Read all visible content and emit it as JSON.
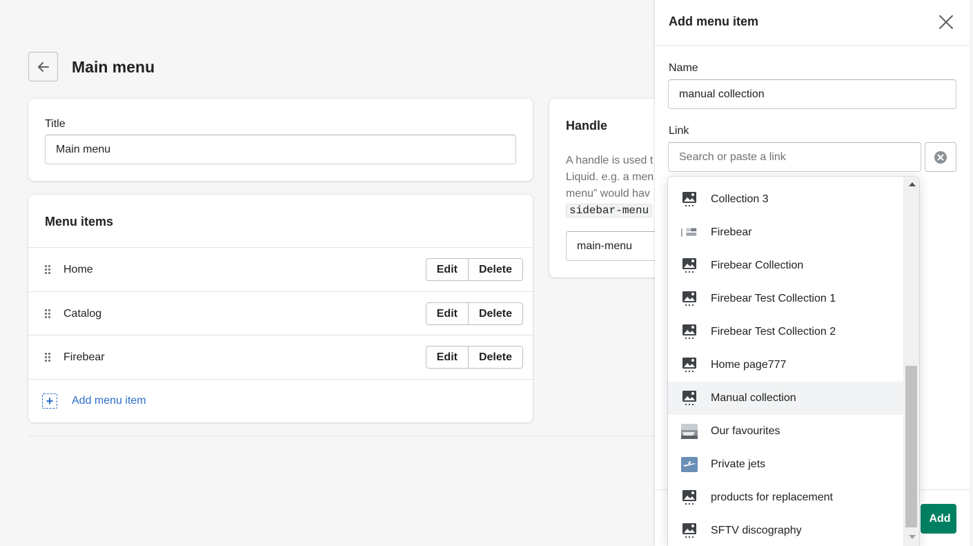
{
  "page": {
    "title": "Main menu"
  },
  "title_card": {
    "label": "Title",
    "value": "Main menu"
  },
  "menu_items": {
    "heading": "Menu items",
    "items": [
      {
        "label": "Home",
        "edit": "Edit",
        "delete": "Delete"
      },
      {
        "label": "Catalog",
        "edit": "Edit",
        "delete": "Delete"
      },
      {
        "label": "Firebear",
        "edit": "Edit",
        "delete": "Delete"
      }
    ],
    "add_label": "Add menu item"
  },
  "handle_card": {
    "heading": "Handle",
    "desc_line1": "A handle is used t",
    "desc_line2": "Liquid. e.g. a men",
    "desc_line3": "menu” would hav",
    "code": "sidebar-menu",
    "value": "main-menu"
  },
  "panel": {
    "title": "Add menu item",
    "name_label": "Name",
    "name_value": "manual collection",
    "link_label": "Link",
    "link_placeholder": "Search or paste a link",
    "add_button": "Add",
    "accent_color": "#008060"
  },
  "dropdown": {
    "options": [
      {
        "label": "Collection 3",
        "thumb": "image-placeholder-icon"
      },
      {
        "label": "Firebear",
        "thumb": "firebear-logo-thumbnail"
      },
      {
        "label": "Firebear Collection",
        "thumb": "image-placeholder-icon"
      },
      {
        "label": "Firebear Test Collection 1",
        "thumb": "image-placeholder-icon"
      },
      {
        "label": "Firebear Test Collection 2",
        "thumb": "image-placeholder-icon"
      },
      {
        "label": "Home page777",
        "thumb": "image-placeholder-icon"
      },
      {
        "label": "Manual collection",
        "thumb": "image-placeholder-icon",
        "selected": true
      },
      {
        "label": "Our favourites",
        "thumb": "photo-thumbnail"
      },
      {
        "label": "Private jets",
        "thumb": "jet-photo-thumbnail"
      },
      {
        "label": "products for replacement",
        "thumb": "image-placeholder-icon"
      },
      {
        "label": "SFTV discography",
        "thumb": "image-placeholder-icon"
      }
    ]
  }
}
